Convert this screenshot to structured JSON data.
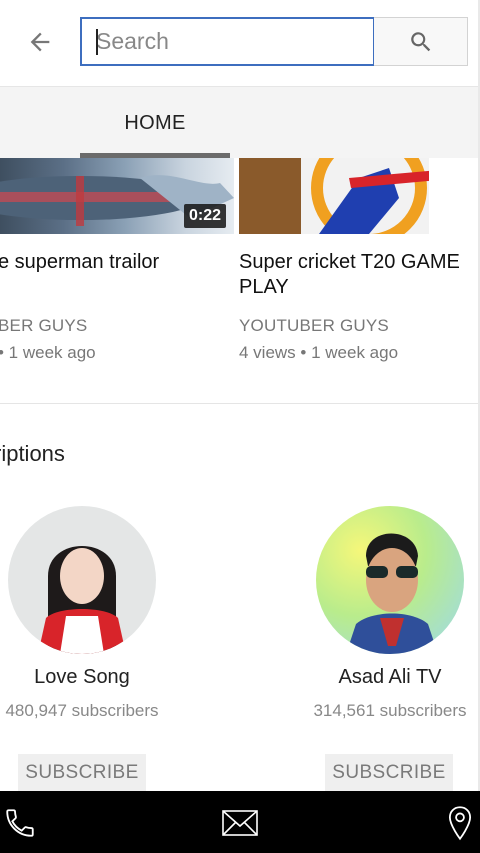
{
  "search": {
    "placeholder": "Search",
    "value": ""
  },
  "icons": {
    "back": "arrow-left-icon",
    "search": "search-icon",
    "phone": "phone-icon",
    "mail": "mail-icon",
    "location": "location-pin-icon"
  },
  "tabs": [
    {
      "label": "HOME",
      "active": true
    }
  ],
  "videos": [
    {
      "title": "e superman trailor",
      "channel": "BER GUYS",
      "meta": "• 1 week ago",
      "duration": "0:22"
    },
    {
      "title": "Super cricket T20 GAME PLAY",
      "channel": "YOUTUBER GUYS",
      "meta": "4 views • 1 week ago"
    }
  ],
  "subscriptions": {
    "title": "riptions",
    "channels": [
      {
        "name": "Love Song",
        "subscribers": "480,947 subscribers",
        "button": "SUBSCRIBE"
      },
      {
        "name": "Asad Ali TV",
        "subscribers": "314,561 subscribers",
        "button": "SUBSCRIBE"
      }
    ]
  },
  "colors": {
    "search_border": "#3d6ebf",
    "tab_bar": "#f4f4f4",
    "bottom_nav": "#000000"
  }
}
